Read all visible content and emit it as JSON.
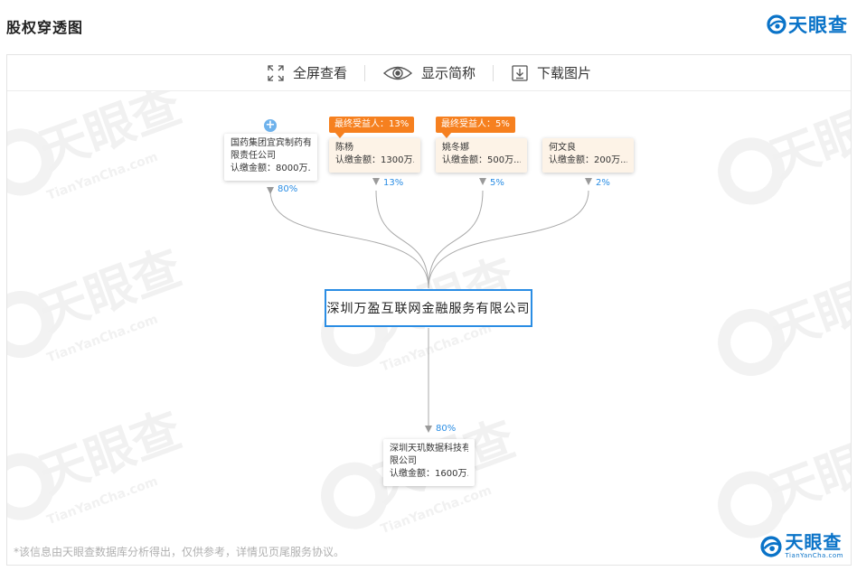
{
  "header": {
    "title": "股权穿透图",
    "brand_name": "天眼查"
  },
  "toolbar": {
    "fullscreen_label": "全屏查看",
    "short_name_label": "显示简称",
    "download_label": "下载图片"
  },
  "watermark": {
    "brand": "天眼查",
    "domain": "TianYanCha.com"
  },
  "diagram": {
    "shareholders": [
      {
        "name": "国药集团宜宾制药有限责任公司",
        "name_lines": [
          "国药集团宜宾制药有",
          "限责任公司"
        ],
        "amount": "认缴金额：8000万...",
        "percent": "80%",
        "is_person": false,
        "tag": ""
      },
      {
        "name": "陈杨",
        "name_lines": [
          "陈杨"
        ],
        "amount": "认缴金额：1300万...",
        "percent": "13%",
        "is_person": true,
        "tag": "最终受益人：13%"
      },
      {
        "name": "姚冬娜",
        "name_lines": [
          "姚冬娜"
        ],
        "amount": "认缴金额：500万...",
        "percent": "5%",
        "is_person": true,
        "tag": "最终受益人：5%"
      },
      {
        "name": "何文良",
        "name_lines": [
          "何文良"
        ],
        "amount": "认缴金额：200万...",
        "percent": "2%",
        "is_person": true,
        "tag": ""
      }
    ],
    "center_company": "深圳万盈互联网金融服务有限公司",
    "subsidiary": {
      "name_lines": [
        "深圳天玑数据科技有",
        "限公司"
      ],
      "amount": "认缴金额：1600万...",
      "percent": "80%"
    }
  },
  "footer": {
    "note": "*该信息由天眼查数据库分析得出，仅供参考，详情见页尾服务协议。",
    "brand_name": "天眼查",
    "brand_domain": "TianYanCha.com"
  },
  "colors": {
    "brand_blue": "#0a73c8",
    "link_blue": "#2a8de4",
    "tag_orange": "#f6801f",
    "person_bg": "#fdf3e7"
  }
}
